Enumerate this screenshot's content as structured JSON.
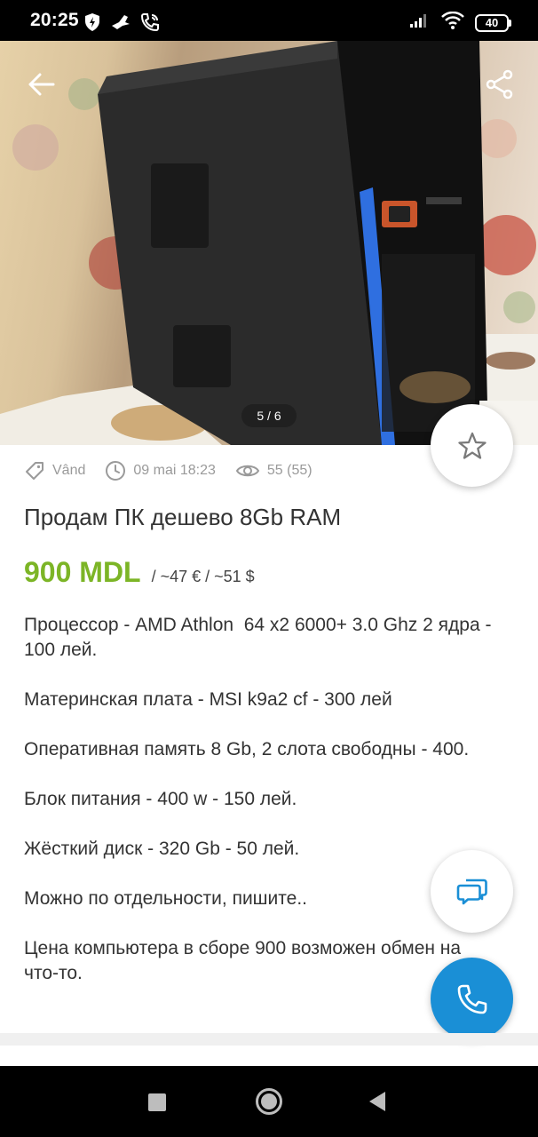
{
  "status_bar": {
    "time": "20:25",
    "battery": "40",
    "icons_left": [
      "shield-icon",
      "bird-icon",
      "call-wifi-icon"
    ],
    "icons_right": [
      "signal-icon",
      "wifi-icon",
      "battery-icon"
    ]
  },
  "gallery": {
    "counter": "5 / 6",
    "current": 5,
    "total": 6
  },
  "meta": {
    "type": "Vând",
    "date": "09 mai 18:23",
    "views": "55 (55)"
  },
  "listing": {
    "title": "Продам ПК дешево 8Gb RAM",
    "price": "900 MDL",
    "price_converted": "/ ~47 € / ~51 $",
    "description": [
      "Процессор - AMD Athlon  64 x2 6000+ 3.0 Ghz 2 ядра - 100 лей.",
      "Материнская плата - MSI k9a2 cf - 300 лей",
      "Оперативная память 8 Gb, 2 слота свободны - 400.",
      "Блок питания - 400 w - 150 лей.",
      "Жёсткий диск - 320 Gb - 50 лей.",
      "Можно по отдельности, пишите..",
      "Цена компьютера в сборе 900 возможен обмен на что-то."
    ]
  },
  "colors": {
    "price": "#7cb526",
    "call_button": "#1a8fd6",
    "chat_icon": "#1a8fd6",
    "meta_text": "#9a9a9a"
  }
}
